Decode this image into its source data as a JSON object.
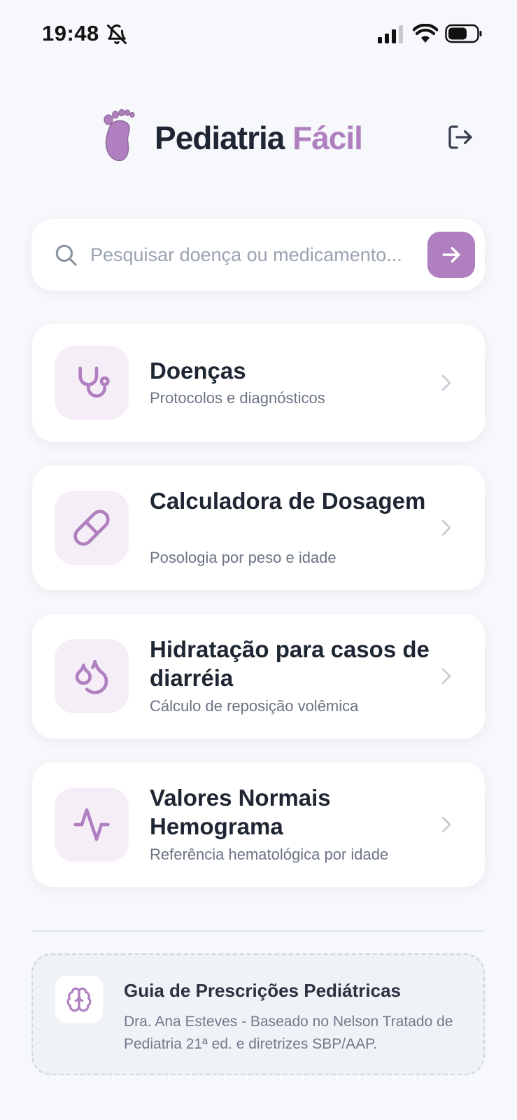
{
  "status_bar": {
    "time": "19:48",
    "icons": [
      "bell-off-icon",
      "signal-icon",
      "wifi-icon",
      "battery-icon"
    ]
  },
  "header": {
    "title_main": "Pediatria",
    "title_accent": "Fácil",
    "logo_icon": "foot-icon",
    "logout_icon": "logout-icon"
  },
  "search": {
    "placeholder": "Pesquisar doença ou medicamento...",
    "value": "",
    "icon": "search-icon",
    "submit_icon": "arrow-right-icon"
  },
  "menu": [
    {
      "title": "Doenças",
      "subtitle": "Protocolos e diagnósticos",
      "icon": "stethoscope-icon"
    },
    {
      "title": "Calculadora de Dosagem",
      "subtitle": "Posologia por peso e idade",
      "icon": "pill-icon"
    },
    {
      "title": "Hidratação para casos de diarréia",
      "subtitle": "Cálculo de reposição volêmica",
      "icon": "droplets-icon"
    },
    {
      "title": "Valores Normais Hemograma",
      "subtitle": "Referência hematológica por idade",
      "icon": "activity-icon"
    }
  ],
  "guide": {
    "title": "Guia de Prescrições Pediátricas",
    "description": "Dra. Ana Esteves - Baseado no Nelson Tratado de Pediatria 21ª ed. e diretrizes SBP/AAP.",
    "icon": "brain-icon"
  },
  "colors": {
    "accent": "#b07fc0",
    "icon_bg": "#f6eef7",
    "background": "#f6f8fb",
    "text_dark": "#1f2633",
    "text_muted": "#6b7483"
  }
}
